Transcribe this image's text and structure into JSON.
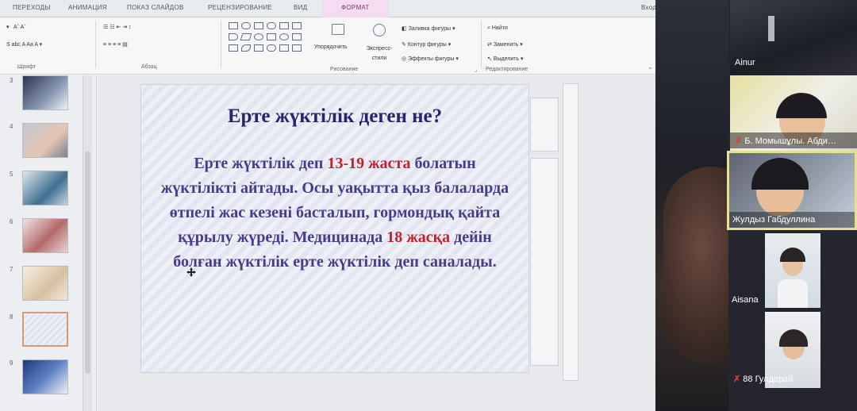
{
  "ribbon": {
    "tabs": [
      "ПЕРЕХОДЫ",
      "АНИМАЦИЯ",
      "ПОКАЗ СЛАЙДОВ",
      "РЕЦЕНЗИРОВАНИЕ",
      "ВИД",
      "ФОРМАТ"
    ],
    "active_tab": "ФОРМАТ",
    "cut_off_tab": "Вход",
    "groups": {
      "font": "Шрифт",
      "paragraph": "Абзац",
      "drawing": "Рисование",
      "editing": "Редактирование"
    },
    "buttons": {
      "arrange": "Упорядочить",
      "express_styles": "Экспресс-стили",
      "shape_fill": "Заливка фигуры",
      "shape_outline": "Контур фигуры",
      "shape_effects": "Эффекты фигуры",
      "find": "Найти",
      "replace": "Заменить",
      "select": "Выделить"
    }
  },
  "slides_panel": {
    "numbers": [
      "3",
      "4",
      "5",
      "6",
      "7",
      "8",
      "9"
    ],
    "selected": "8"
  },
  "slide": {
    "title": "Ерте жүктілік деген не?",
    "body_1": "Ерте жүктілік деп ",
    "body_hl1": "13-19 жаста",
    "body_2": " болатын жүктілікті айтады. Осы уақытта қыз балаларда өтпелі жас кезені басталып, гормондық қайта құрылу жүреді. Медицинада ",
    "body_hl2": "18 жасқа",
    "body_3": " дейін болған жүктілік ерте жүктілік деп саналады."
  },
  "participants": [
    {
      "name": "Ainur"
    },
    {
      "name": "Б. Момышұлы. Абди…",
      "muted": true
    },
    {
      "name": "Жулдыз Габдуллина",
      "active": true
    },
    {
      "name": "Aisana"
    },
    {
      "name": "88 Гулдерай",
      "muted": true
    }
  ],
  "colors": {
    "accent_tab": "#f5dcf1",
    "title": "#2b2370",
    "body": "#4a3a8a",
    "highlight": "#c51f2e",
    "speaker_frame": "#e8e08a"
  }
}
